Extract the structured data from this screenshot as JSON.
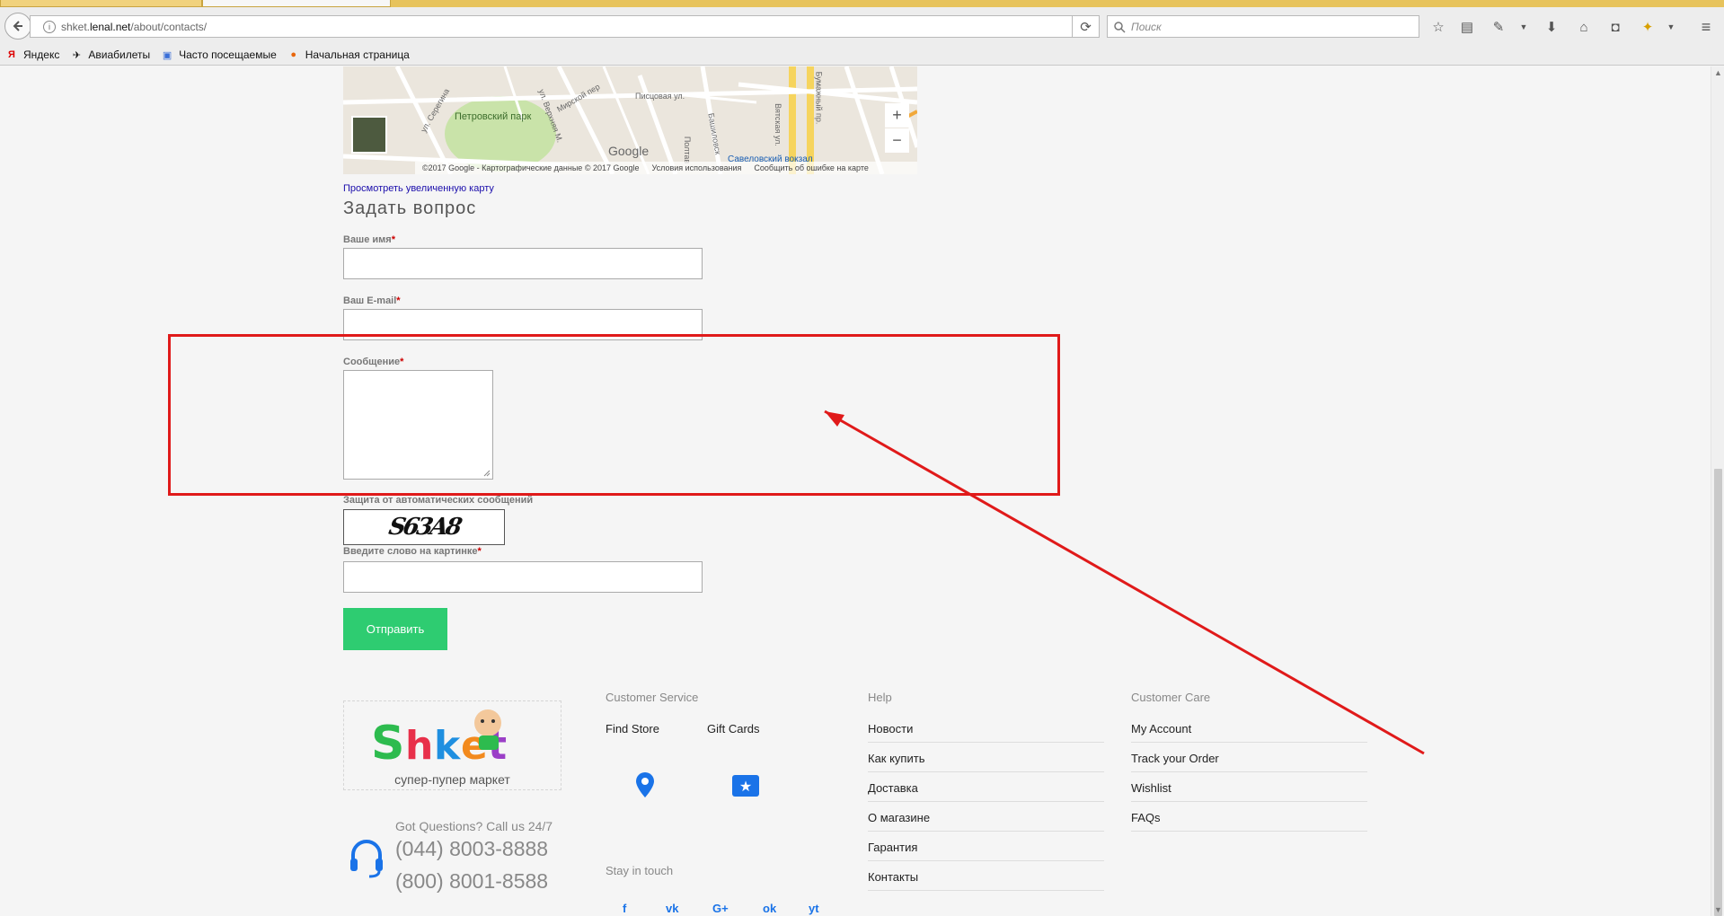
{
  "browser": {
    "url_prefix": "shket.",
    "url_host": "lenal.net",
    "url_path": "/about/contacts/",
    "search_placeholder": "Поиск",
    "bookmarks": [
      "Яндекс",
      "Авиабилеты",
      "Часто посещаемые",
      "Начальная страница"
    ]
  },
  "map": {
    "streets": [
      "Петровский парк",
      "ул. Серегина",
      "ул. Верхняя М.",
      "Мирской пер",
      "Писцовая ул.",
      "Башиловск",
      "Вятская ул.",
      "Бумажный пр.",
      "Полтав",
      "Савеловский вокзал"
    ],
    "logo": "Google",
    "credit": "©2017 Google - Картографические данные © 2017 Google",
    "terms": "Условия использования",
    "report": "Сообщить об ошибке на карте",
    "zoom_in": "+",
    "zoom_out": "−",
    "larger_link": "Просмотреть увеличенную карту"
  },
  "form": {
    "title": "Задать вопрос",
    "name_label": "Ваше имя",
    "email_label": "Ваш E-mail",
    "message_label": "Сообщение",
    "required_mark": "*",
    "captcha_label": "Защита от автоматических сообщений",
    "captcha_text": "S63A8",
    "captcha_input_label": "Введите слово на картинке",
    "submit_label": "Отправить"
  },
  "footer": {
    "logo_text": "Shket",
    "tagline": "супер-пупер маркет",
    "questions": "Got Questions? Call us 24/7",
    "phones": [
      "(044) 8003-8888",
      "(800) 8001-8588"
    ],
    "customer_service": {
      "title": "Customer Service",
      "items": [
        "Find Store",
        "Gift Cards"
      ],
      "stay": "Stay in touch"
    },
    "help": {
      "title": "Help",
      "items": [
        "Новости",
        "Как купить",
        "Доставка",
        "О магазине",
        "Гарантия",
        "Контакты"
      ]
    },
    "care": {
      "title": "Customer Care",
      "items": [
        "My Account",
        "Track your Order",
        "Wishlist",
        "FAQs"
      ]
    },
    "social": [
      "f",
      "vk",
      "G+",
      "ok",
      "yt"
    ]
  },
  "colors": {
    "accent_green": "#2ecc71",
    "annotation_red": "#e01a1a",
    "link_blue": "#1a73e8"
  }
}
